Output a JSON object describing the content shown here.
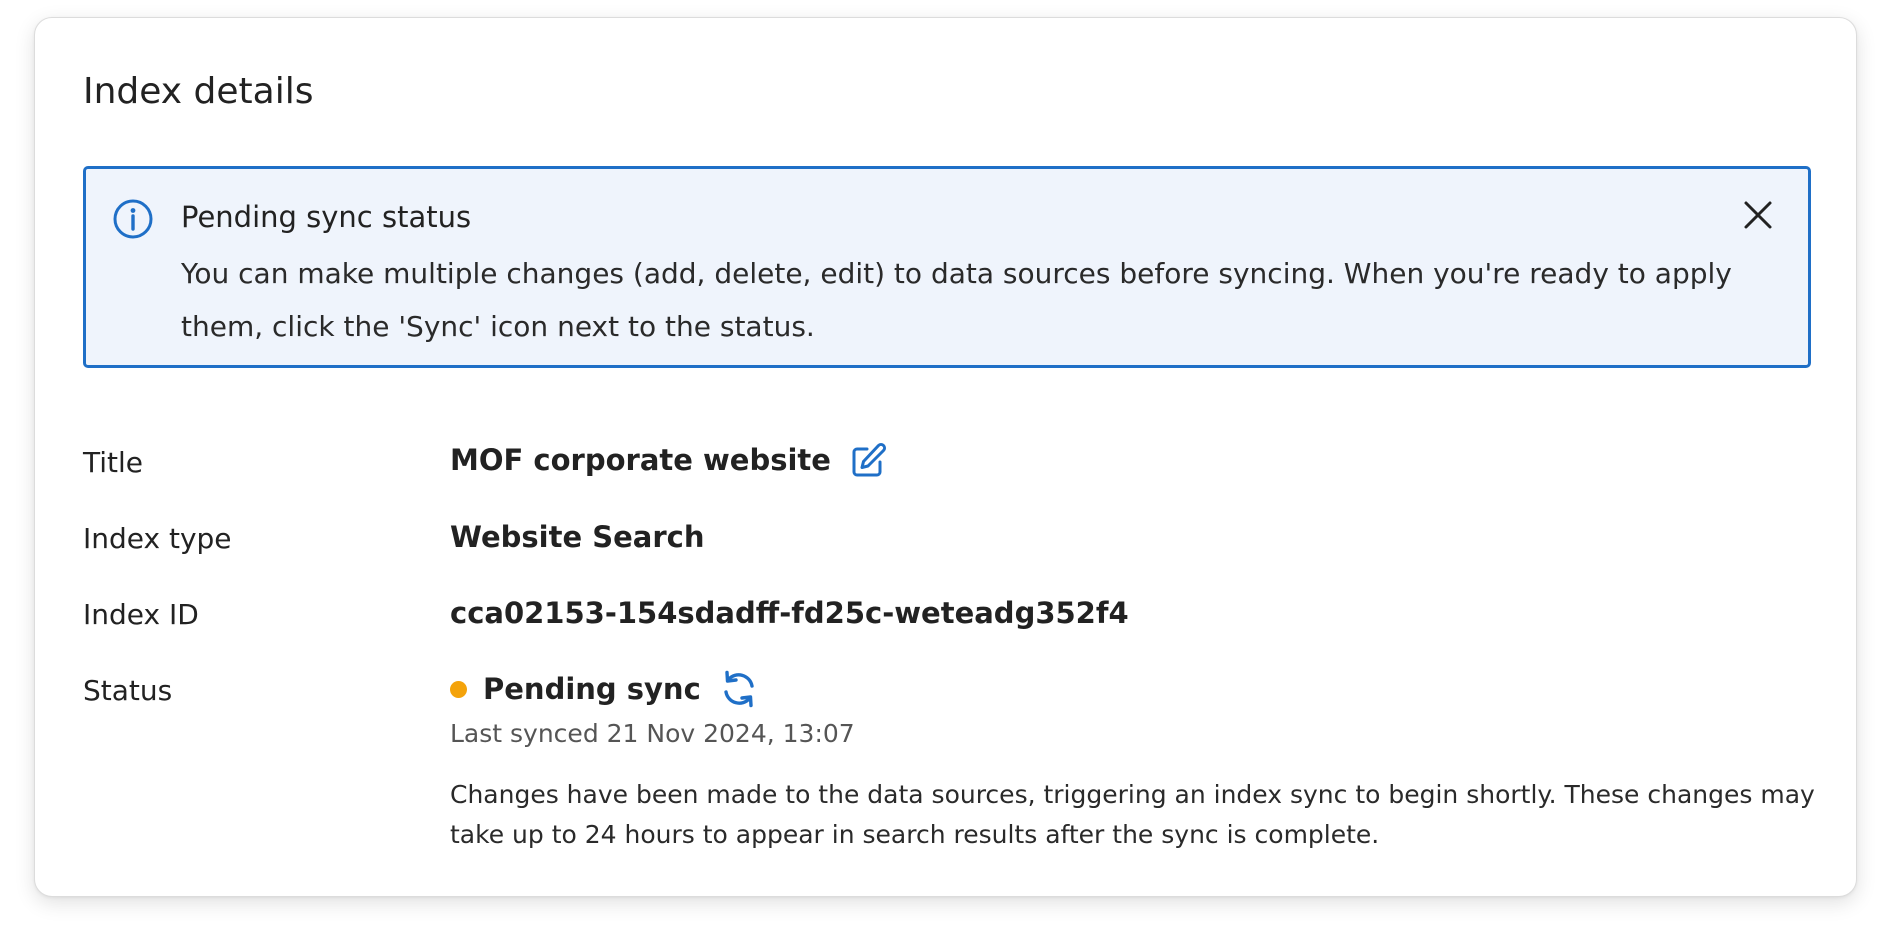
{
  "card": {
    "title": "Index details"
  },
  "banner": {
    "heading": "Pending sync status",
    "text": "You can make multiple changes (add, delete, edit) to data sources before syncing. When you're ready to apply them, click the 'Sync' icon next to the status.",
    "info_icon": "info-circle-icon",
    "close_icon": "close-icon",
    "accent_color": "#1f6fc7",
    "background_color": "#eff4fc"
  },
  "details": {
    "title": {
      "label": "Title",
      "value": "MOF corporate website",
      "edit_icon": "edit-pencil-icon"
    },
    "index_type": {
      "label": "Index type",
      "value": "Website Search"
    },
    "index_id": {
      "label": "Index ID",
      "value": "cca02153-154sdadff-fd25c-weteadg352f4"
    },
    "status": {
      "label": "Status",
      "value": "Pending sync",
      "dot_color": "#f4a30b",
      "sync_icon": "sync-refresh-icon",
      "last_synced": "Last synced 21 Nov 2024, 13:07",
      "note": "Changes have been made to the data sources, triggering an index sync to begin shortly. These changes may take up to 24 hours to appear in search results after the sync is complete."
    }
  }
}
